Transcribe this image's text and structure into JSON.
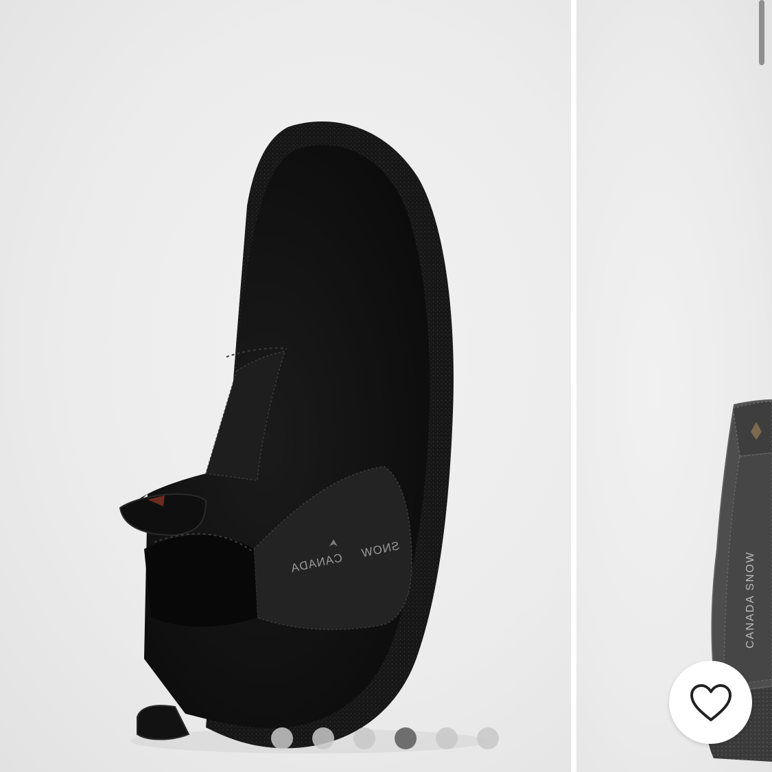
{
  "carousel": {
    "main_slide": {
      "brand_left": "CANADA",
      "brand_right": "SNOW"
    },
    "next_slide": {
      "brand_vertical": "CANADA  SNOW"
    },
    "pagination": {
      "total": 6,
      "active_index": 3
    }
  },
  "favorite": {
    "icon": "heart-outline-icon"
  },
  "colors": {
    "background": "#ececec",
    "boot": "#141414",
    "active_dot": "#5a5a5a",
    "inactive_dot": "#c8c8c8"
  }
}
